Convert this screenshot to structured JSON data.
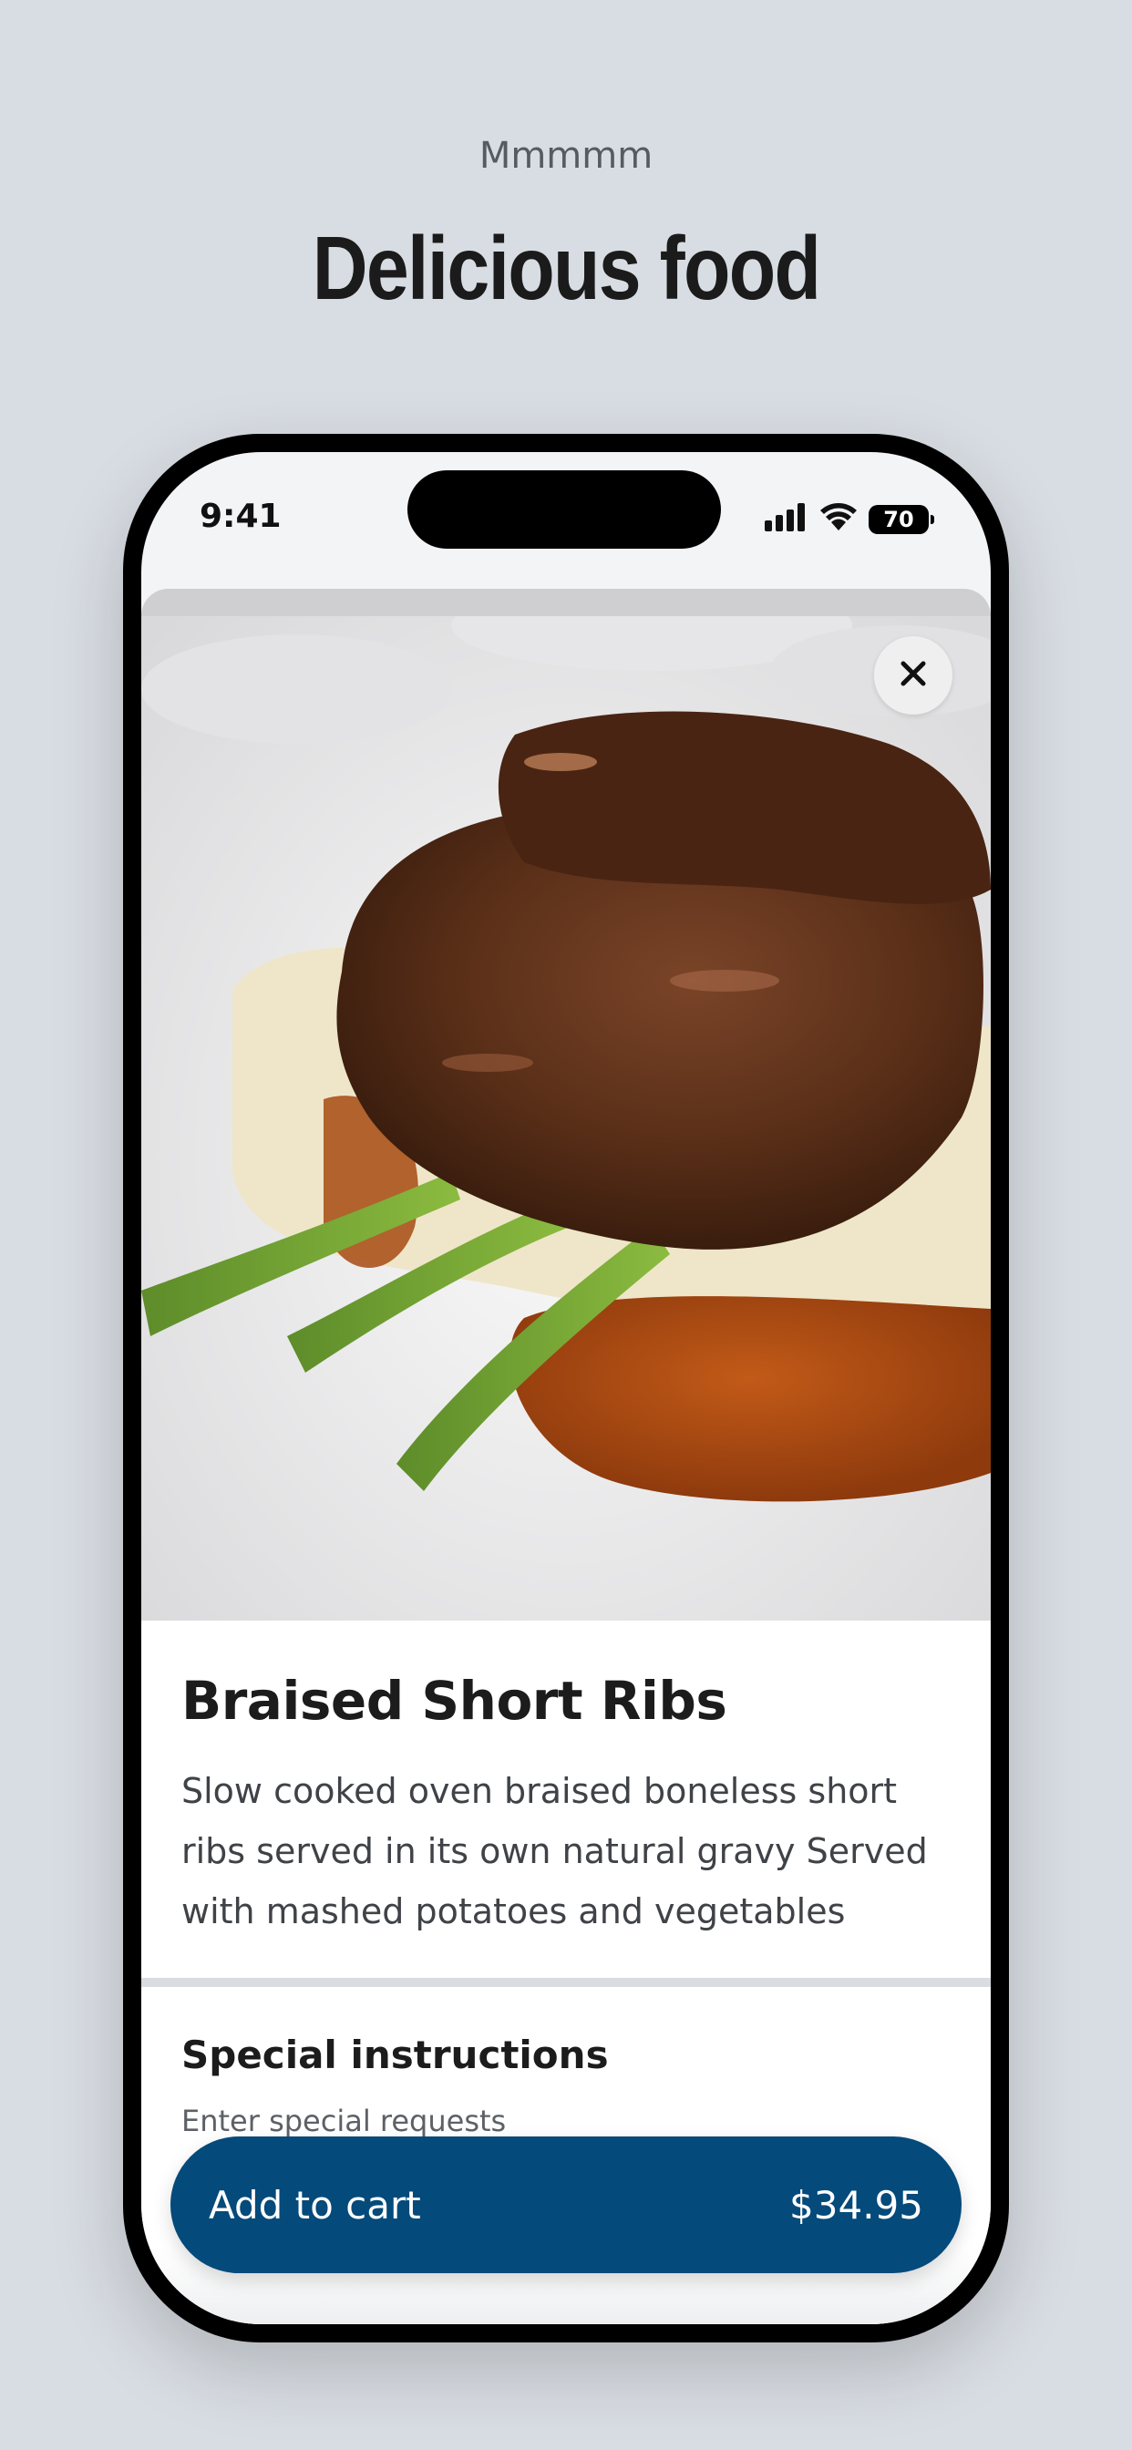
{
  "promo": {
    "eyebrow": "Mmmmm",
    "headline": "Delicious food"
  },
  "status_bar": {
    "time": "9:41",
    "battery": "70"
  },
  "item": {
    "image_alt": "Braised short ribs with mashed potatoes and asparagus",
    "title": "Braised Short Ribs",
    "description": "Slow cooked oven braised boneless short ribs served in its own natural gravy Served with mashed potatoes and vegetables"
  },
  "special_instructions": {
    "title": "Special instructions",
    "placeholder": "Enter special requests"
  },
  "cart": {
    "label": "Add to cart",
    "price": "$34.95",
    "color": "#044a7a"
  },
  "icons": {
    "close": "close-icon",
    "signal": "cellular-signal-icon",
    "wifi": "wifi-icon",
    "battery": "battery-icon"
  }
}
